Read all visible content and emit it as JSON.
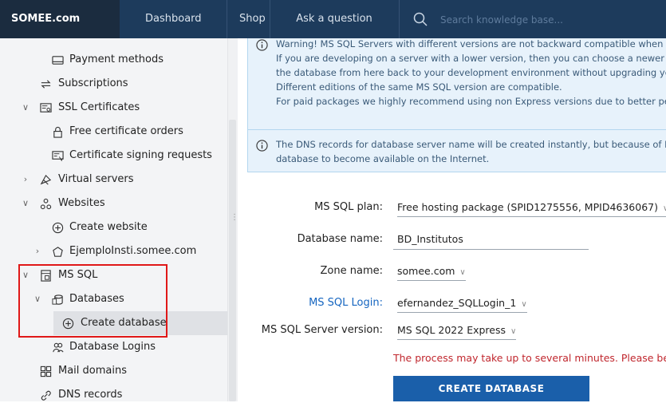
{
  "topbar": {
    "brand": "SOMEE.com",
    "nav": [
      "Dashboard",
      "Shop",
      "Ask a question"
    ],
    "search_placeholder": "Search knowledge base..."
  },
  "sidebar": {
    "items": [
      {
        "label": "Payment methods",
        "icon": "card-icon"
      },
      {
        "label": "Subscriptions",
        "icon": "refresh-icon"
      },
      {
        "label": "SSL Certificates",
        "icon": "certificate-icon"
      },
      {
        "label": "Free certificate orders",
        "icon": "lock-icon"
      },
      {
        "label": "Certificate signing requests",
        "icon": "csr-icon"
      },
      {
        "label": "Virtual servers",
        "icon": "virtual-server-icon"
      },
      {
        "label": "Websites",
        "icon": "websites-icon"
      },
      {
        "label": "Create website",
        "icon": "add-circle-icon"
      },
      {
        "label": "EjemploInsti.somee.com",
        "icon": "website-node-icon"
      },
      {
        "label": "MS SQL",
        "icon": "database-server-icon"
      },
      {
        "label": "Databases",
        "icon": "databases-icon"
      },
      {
        "label": "Create database",
        "icon": "add-circle-icon"
      },
      {
        "label": "Database Logins",
        "icon": "users-icon"
      },
      {
        "label": "Mail domains",
        "icon": "grid-icon"
      },
      {
        "label": "DNS records",
        "icon": "link-icon"
      }
    ]
  },
  "alerts": {
    "warning_lines": [
      "Warning! MS SQL Servers with different versions are not backward compatible when resto",
      "If you are developing on a server with a lower version, then you can choose a newer versio",
      "the database from here back to your development environment without upgrading your M",
      "Different editions of the same MS SQL version are compatible.",
      "For paid packages we highly recommend using non Express versions due to better perform"
    ],
    "dns_lines": [
      "The DNS records for database server name will be created instantly, but because of DNS re",
      "database to become available on the Internet."
    ]
  },
  "form": {
    "plan_label": "MS SQL plan:",
    "plan_value": "Free hosting package (SPID1275556, MPID4636067)",
    "dbname_label": "Database name:",
    "dbname_value": "BD_Institutos",
    "zone_label": "Zone name:",
    "zone_value": "somee.com",
    "login_label": "MS SQL Login:",
    "login_value": "efernandez_SQLLogin_1",
    "version_label": "MS SQL Server version:",
    "version_value": "MS SQL 2022 Express",
    "notice": "The process may take up to several minutes. Please be patient.",
    "submit": "CREATE DATABASE"
  },
  "colors": {
    "topbar": "#1d3b5c",
    "brand_bg": "#1b2c3f",
    "button": "#1a5faa",
    "notice": "#c0262d",
    "highlight_box": "#e01818",
    "alert_bg": "#e7f2fb"
  }
}
